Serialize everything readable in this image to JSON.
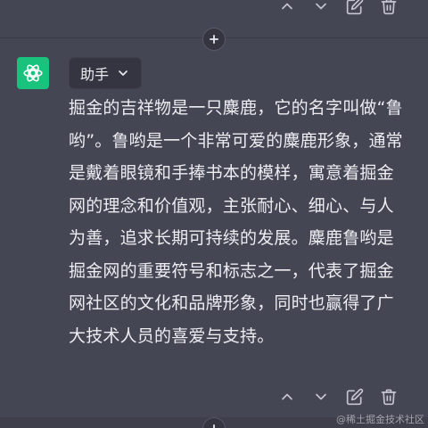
{
  "top_toolbar": {
    "icons": [
      "chevron-up-icon",
      "chevron-down-icon",
      "edit-icon",
      "trash-icon"
    ]
  },
  "message": {
    "role_selector_value": "助手",
    "content": "掘金的吉祥物是一只麋鹿，它的名字叫做“鲁哟”。鲁哟是一个非常可爱的麋鹿形象，通常是戴着眼镜和手捧书本的模样，寓意着掘金网的理念和价值观，主张耐心、细心、与人为善，追求长期可持续的发展。麋鹿鲁哟是掘金网的重要符号和标志之一，代表了掘金网社区的文化和品牌形象，同时也赢得了广大技术人员的喜爱与支持。"
  },
  "bottom_toolbar": {
    "icons": [
      "chevron-up-icon",
      "chevron-down-icon",
      "edit-icon",
      "trash-icon"
    ]
  },
  "watermark": "@稀土掘金技术社区",
  "colors": {
    "background": "#444654",
    "avatar_bg": "#19c37d",
    "text": "#ececf1"
  }
}
